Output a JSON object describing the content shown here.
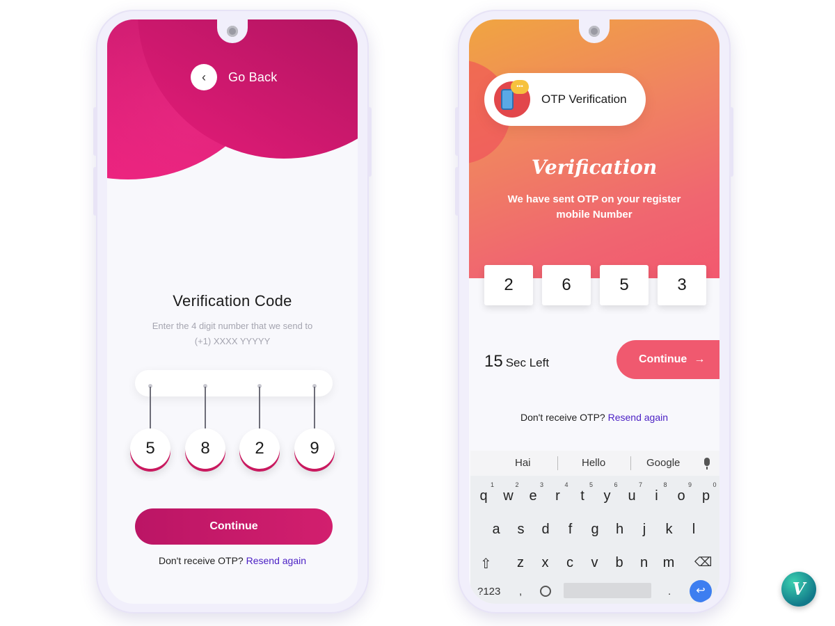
{
  "left": {
    "back_label": "Go Back",
    "title": "Verification Code",
    "subtitle_line1": "Enter the 4 digit number that we send to",
    "subtitle_line2": "(+1) XXXX YYYYY",
    "digits": [
      "5",
      "8",
      "2",
      "9"
    ],
    "continue_label": "Continue",
    "resend_prefix": "Don't receive OTP?",
    "resend_link": "Resend again"
  },
  "right": {
    "pill_label": "OTP Verification",
    "title": "Verification",
    "subtitle_line1": "We have sent OTP on your register",
    "subtitle_line2": "mobile Number",
    "digits": [
      "2",
      "6",
      "5",
      "3"
    ],
    "timer_value": "15",
    "timer_label": "Sec Left",
    "continue_label": "Continue",
    "continue_arrow": "→",
    "resend_prefix": "Don't receive OTP?",
    "resend_link": "Resend again",
    "keyboard": {
      "suggestions": [
        "Hai",
        "Hello",
        "Google"
      ],
      "row1": [
        "q",
        "w",
        "e",
        "r",
        "t",
        "y",
        "u",
        "i",
        "o",
        "p"
      ],
      "row1_nums": [
        "1",
        "2",
        "3",
        "4",
        "5",
        "6",
        "7",
        "8",
        "9",
        "0"
      ],
      "row2": [
        "a",
        "s",
        "d",
        "f",
        "g",
        "h",
        "j",
        "k",
        "l"
      ],
      "row3": [
        "z",
        "x",
        "c",
        "v",
        "b",
        "n",
        "m"
      ],
      "symbols_key": "?123",
      "comma_key": ",",
      "period_key": ".",
      "shift_key": "⇧",
      "delete_key": "⌫",
      "enter_key": "↩"
    },
    "bubble_text": "•••"
  },
  "badge_letter": "V",
  "colors": {
    "left_accent": "#c9195f",
    "right_accent": "#f0596f",
    "link": "#4a1fc4"
  },
  "icons": [
    "chevron-left-icon",
    "otp-phone-icon",
    "arrow-right-icon",
    "mic-icon",
    "shift-icon",
    "backspace-icon",
    "enter-icon"
  ]
}
